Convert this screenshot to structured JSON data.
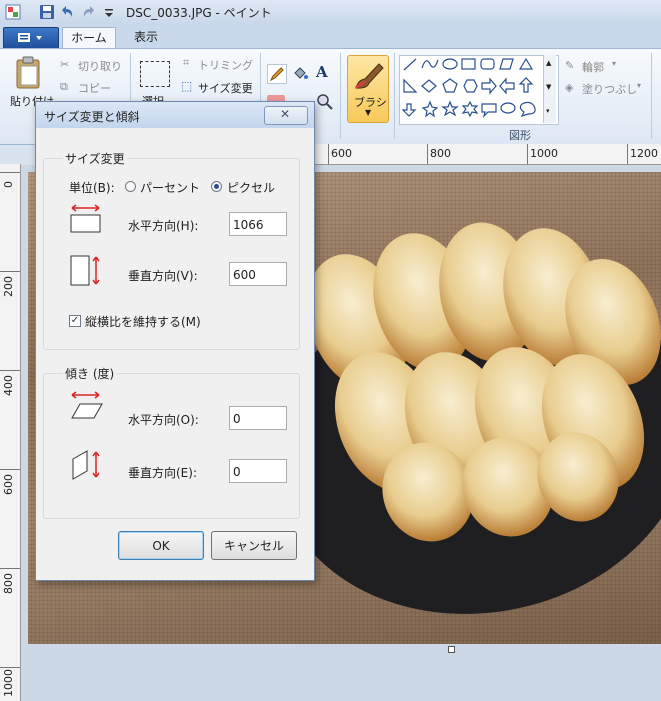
{
  "window": {
    "title": "DSC_0033.JPG - ペイント"
  },
  "tabs": {
    "home": "ホーム",
    "view": "表示"
  },
  "ribbon": {
    "paste": "貼り付け",
    "cut": "切り取り",
    "copy": "コピー",
    "select": "選択",
    "crop": "トリミング",
    "resize": "サイズ変更",
    "brush": "ブラシ",
    "outline": "輪郭",
    "fill": "塗りつぶし",
    "shapes_group": "図形"
  },
  "ruler": {
    "h_labels": [
      "600",
      "800",
      "1000",
      "1200"
    ],
    "v_labels": [
      "0",
      "200",
      "400",
      "600",
      "800",
      "1000"
    ]
  },
  "dialog": {
    "title": "サイズ変更と傾斜",
    "close_glyph": "✕",
    "resize_group": "サイズ変更",
    "unit_label": "単位(B):",
    "percent_label": "パーセント",
    "pixel_label": "ピクセル",
    "unit_selected": "pixel",
    "horizontal_label": "水平方向(H):",
    "horizontal_value": "1066",
    "vertical_label": "垂直方向(V):",
    "vertical_value": "600",
    "keep_ratio_label": "縦横比を維持する(M)",
    "keep_ratio_checked": true,
    "skew_group": "傾き (度)",
    "skew_horizontal_label": "水平方向(O):",
    "skew_horizontal_value": "0",
    "skew_vertical_label": "垂直方向(E):",
    "skew_vertical_value": "0",
    "ok_label": "OK",
    "cancel_label": "キャンセル"
  },
  "colors": {
    "accent": "#1f4f9b",
    "brush_highlight": "#f7c95a"
  }
}
